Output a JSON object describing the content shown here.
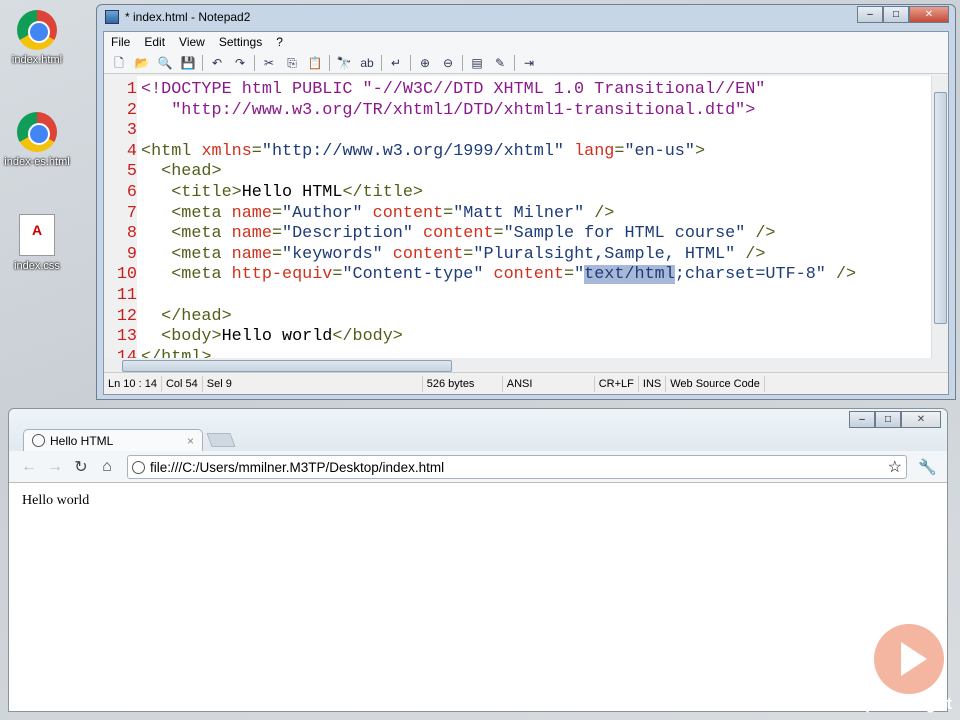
{
  "desktop": {
    "icons": [
      {
        "label": "index.html"
      },
      {
        "label": "index-es.html"
      },
      {
        "label": "index.css"
      }
    ]
  },
  "notepad": {
    "title": "* index.html - Notepad2",
    "menu": [
      "File",
      "Edit",
      "View",
      "Settings",
      "?"
    ],
    "lines": [
      [
        [
          "doc",
          "<!DOCTYPE html PUBLIC \"-//W3C//DTD XHTML 1.0 Transitional//EN\""
        ]
      ],
      [
        [
          "doc",
          "   \"http://www.w3.org/TR/xhtml1/DTD/xhtml1-transitional.dtd\">"
        ]
      ],
      [],
      [
        [
          "tag",
          "<html "
        ],
        [
          "attr",
          "xmlns"
        ],
        [
          "tag",
          "="
        ],
        [
          "val",
          "\"http://www.w3.org/1999/xhtml\" "
        ],
        [
          "attr",
          "lang"
        ],
        [
          "tag",
          "="
        ],
        [
          "val",
          "\"en-us\""
        ],
        [
          "tag",
          ">"
        ]
      ],
      [
        [
          "tag",
          "  <head>"
        ]
      ],
      [
        [
          "tag",
          "   <title>"
        ],
        [
          "txt",
          "Hello HTML"
        ],
        [
          "tag",
          "</title>"
        ]
      ],
      [
        [
          "tag",
          "   <meta "
        ],
        [
          "attr",
          "name"
        ],
        [
          "tag",
          "="
        ],
        [
          "val",
          "\"Author\" "
        ],
        [
          "attr",
          "content"
        ],
        [
          "tag",
          "="
        ],
        [
          "val",
          "\"Matt Milner\" "
        ],
        [
          "tag",
          "/>"
        ]
      ],
      [
        [
          "tag",
          "   <meta "
        ],
        [
          "attr",
          "name"
        ],
        [
          "tag",
          "="
        ],
        [
          "val",
          "\"Description\" "
        ],
        [
          "attr",
          "content"
        ],
        [
          "tag",
          "="
        ],
        [
          "val",
          "\"Sample for HTML course\" "
        ],
        [
          "tag",
          "/>"
        ]
      ],
      [
        [
          "tag",
          "   <meta "
        ],
        [
          "attr",
          "name"
        ],
        [
          "tag",
          "="
        ],
        [
          "val",
          "\"keywords\" "
        ],
        [
          "attr",
          "content"
        ],
        [
          "tag",
          "="
        ],
        [
          "val",
          "\"Pluralsight,Sample, HTML\" "
        ],
        [
          "tag",
          "/>"
        ]
      ],
      [
        [
          "tag",
          "   <meta "
        ],
        [
          "attr",
          "http-equiv"
        ],
        [
          "tag",
          "="
        ],
        [
          "val",
          "\"Content-type\" "
        ],
        [
          "attr",
          "content"
        ],
        [
          "tag",
          "="
        ],
        [
          "val",
          "\""
        ],
        [
          "sel",
          "text/html"
        ],
        [
          "val",
          ";charset=UTF-8\" "
        ],
        [
          "tag",
          "/>"
        ]
      ],
      [],
      [
        [
          "tag",
          "  </head>"
        ]
      ],
      [
        [
          "tag",
          "  <body>"
        ],
        [
          "txt",
          "Hello world"
        ],
        [
          "tag",
          "</body>"
        ]
      ],
      [
        [
          "tag",
          "</html>"
        ]
      ]
    ],
    "status": {
      "position": "Ln 10 : 14",
      "col": "Col 54",
      "sel": "Sel 9",
      "size": "526 bytes",
      "encoding": "ANSI",
      "eol": "CR+LF",
      "mode": "INS",
      "scheme": "Web Source Code"
    }
  },
  "browser": {
    "tab_title": "Hello HTML",
    "url": "file:///C:/Users/mmilner.M3TP/Desktop/index.html",
    "content": "Hello world"
  },
  "watermark": {
    "text": "pluralsight"
  }
}
